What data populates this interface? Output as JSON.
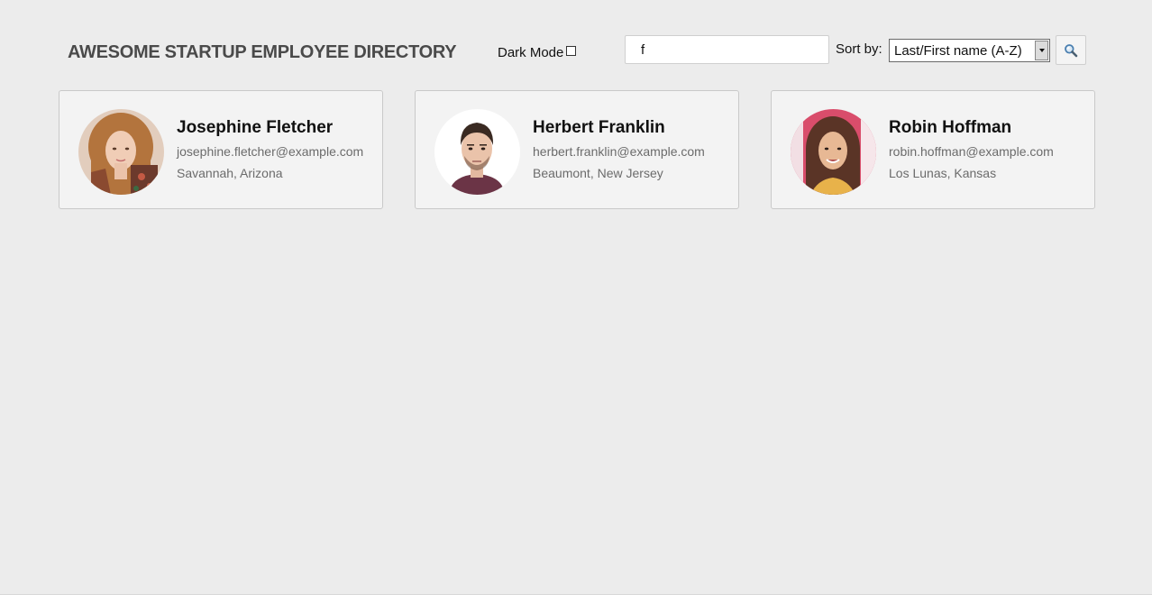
{
  "header": {
    "title": "AWESOME STARTUP EMPLOYEE DIRECTORY",
    "dark_mode_label": "Dark Mode",
    "dark_mode_checked": false
  },
  "search": {
    "value": "f",
    "placeholder": "",
    "button_icon": "search-icon"
  },
  "sort": {
    "label": "Sort by:",
    "selected": "Last/First name (A-Z)"
  },
  "employees": [
    {
      "name": "Josephine Fletcher",
      "email": "josephine.fletcher@example.com",
      "location": "Savannah, Arizona"
    },
    {
      "name": "Herbert Franklin",
      "email": "herbert.franklin@example.com",
      "location": "Beaumont, New Jersey"
    },
    {
      "name": "Robin Hoffman",
      "email": "robin.hoffman@example.com",
      "location": "Los Lunas, Kansas"
    }
  ],
  "colors": {
    "background": "#ececec",
    "card_background": "#f3f3f3",
    "card_border": "#c9c9c9",
    "title_text": "#4a4a4a",
    "secondary_text": "#6b6b6b"
  }
}
